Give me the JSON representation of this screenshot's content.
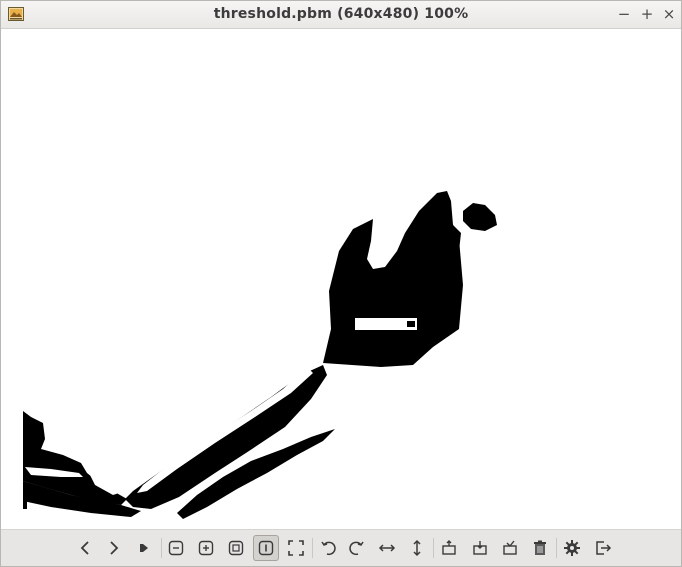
{
  "window": {
    "title": "threshold.pbm (640x480) 100%",
    "controls": {
      "minimize": "−",
      "maximize": "+",
      "close": "×"
    }
  },
  "image": {
    "description_icon": "binary-threshold-image",
    "foreground": "#000000",
    "background": "#ffffff"
  },
  "toolbar": {
    "buttons": [
      {
        "name": "previous-button",
        "icon": "chevron-left-icon"
      },
      {
        "name": "next-button",
        "icon": "chevron-right-icon"
      },
      {
        "name": "slideshow-button",
        "icon": "play-icon"
      },
      {
        "name": "zoom-out-button",
        "icon": "zoom-out-icon"
      },
      {
        "name": "zoom-in-button",
        "icon": "zoom-in-icon"
      },
      {
        "name": "zoom-fit-button",
        "icon": "fit-window-icon"
      },
      {
        "name": "zoom-original-button",
        "icon": "original-size-icon",
        "active": true
      },
      {
        "name": "fullscreen-button",
        "icon": "fullscreen-icon"
      },
      {
        "name": "rotate-left-button",
        "icon": "rotate-left-icon"
      },
      {
        "name": "rotate-right-button",
        "icon": "rotate-right-icon"
      },
      {
        "name": "flip-horizontal-button",
        "icon": "flip-horizontal-icon"
      },
      {
        "name": "flip-vertical-button",
        "icon": "flip-vertical-icon"
      },
      {
        "name": "open-button",
        "icon": "open-file-icon"
      },
      {
        "name": "save-button",
        "icon": "save-file-icon"
      },
      {
        "name": "save-as-button",
        "icon": "save-as-icon"
      },
      {
        "name": "delete-button",
        "icon": "trash-icon"
      },
      {
        "name": "preferences-button",
        "icon": "gear-icon"
      },
      {
        "name": "quit-button",
        "icon": "exit-icon"
      }
    ]
  }
}
